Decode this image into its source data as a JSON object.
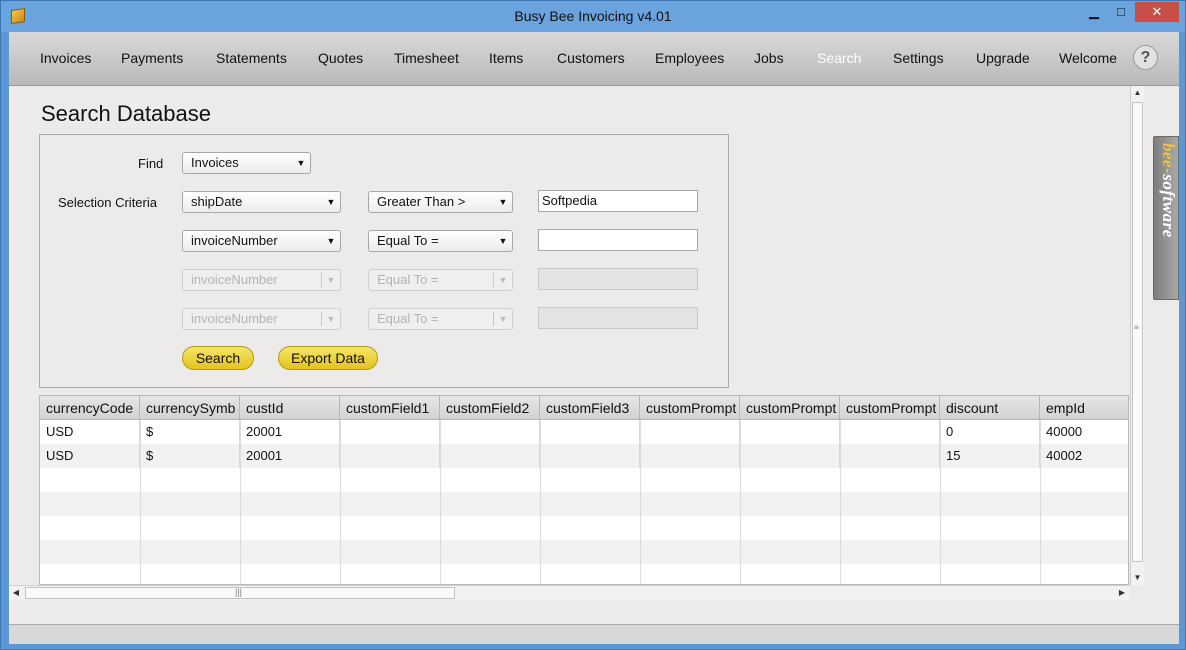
{
  "window": {
    "title": "Busy Bee Invoicing v4.01",
    "min": "▁",
    "max": "□",
    "close": "✕"
  },
  "nav": {
    "items": [
      {
        "label": "Invoices"
      },
      {
        "label": "Payments"
      },
      {
        "label": "Statements"
      },
      {
        "label": "Quotes"
      },
      {
        "label": "Timesheet"
      },
      {
        "label": "Items"
      },
      {
        "label": "Customers"
      },
      {
        "label": "Employees"
      },
      {
        "label": "Jobs"
      },
      {
        "label": "Search"
      },
      {
        "label": "Settings"
      },
      {
        "label": "Upgrade"
      },
      {
        "label": "Welcome"
      }
    ],
    "active": "Search",
    "help": "?"
  },
  "page": {
    "title": "Search Database"
  },
  "form": {
    "find_label": "Find",
    "find_value": "Invoices",
    "criteria_label": "Selection Criteria",
    "rows": [
      {
        "field": "shipDate",
        "op": "Greater Than >",
        "value": "Softpedia",
        "enabled": true
      },
      {
        "field": "invoiceNumber",
        "op": "Equal To =",
        "value": "",
        "enabled": true
      },
      {
        "field": "invoiceNumber",
        "op": "Equal To =",
        "value": "",
        "enabled": false
      },
      {
        "field": "invoiceNumber",
        "op": "Equal To =",
        "value": "",
        "enabled": false
      }
    ],
    "search_button": "Search",
    "export_button": "Export Data"
  },
  "table": {
    "columns": [
      "currencyCode",
      "currencySymb",
      "custId",
      "customField1",
      "customField2",
      "customField3",
      "customPrompt",
      "customPrompt",
      "customPrompt",
      "discount",
      "empId"
    ],
    "rows": [
      [
        "USD",
        "$",
        "20001",
        "",
        "",
        "",
        "",
        "",
        "",
        "0",
        "40000"
      ],
      [
        "USD",
        "$",
        "20001",
        "",
        "",
        "",
        "",
        "",
        "",
        "15",
        "40002"
      ]
    ]
  },
  "brand_tab": {
    "part1": "bee",
    "dash": "-",
    "part2": "software"
  },
  "colors": {
    "accent_button": "#e8cd2a",
    "window_blue": "#6aa3de",
    "close_red": "#c74f48"
  }
}
